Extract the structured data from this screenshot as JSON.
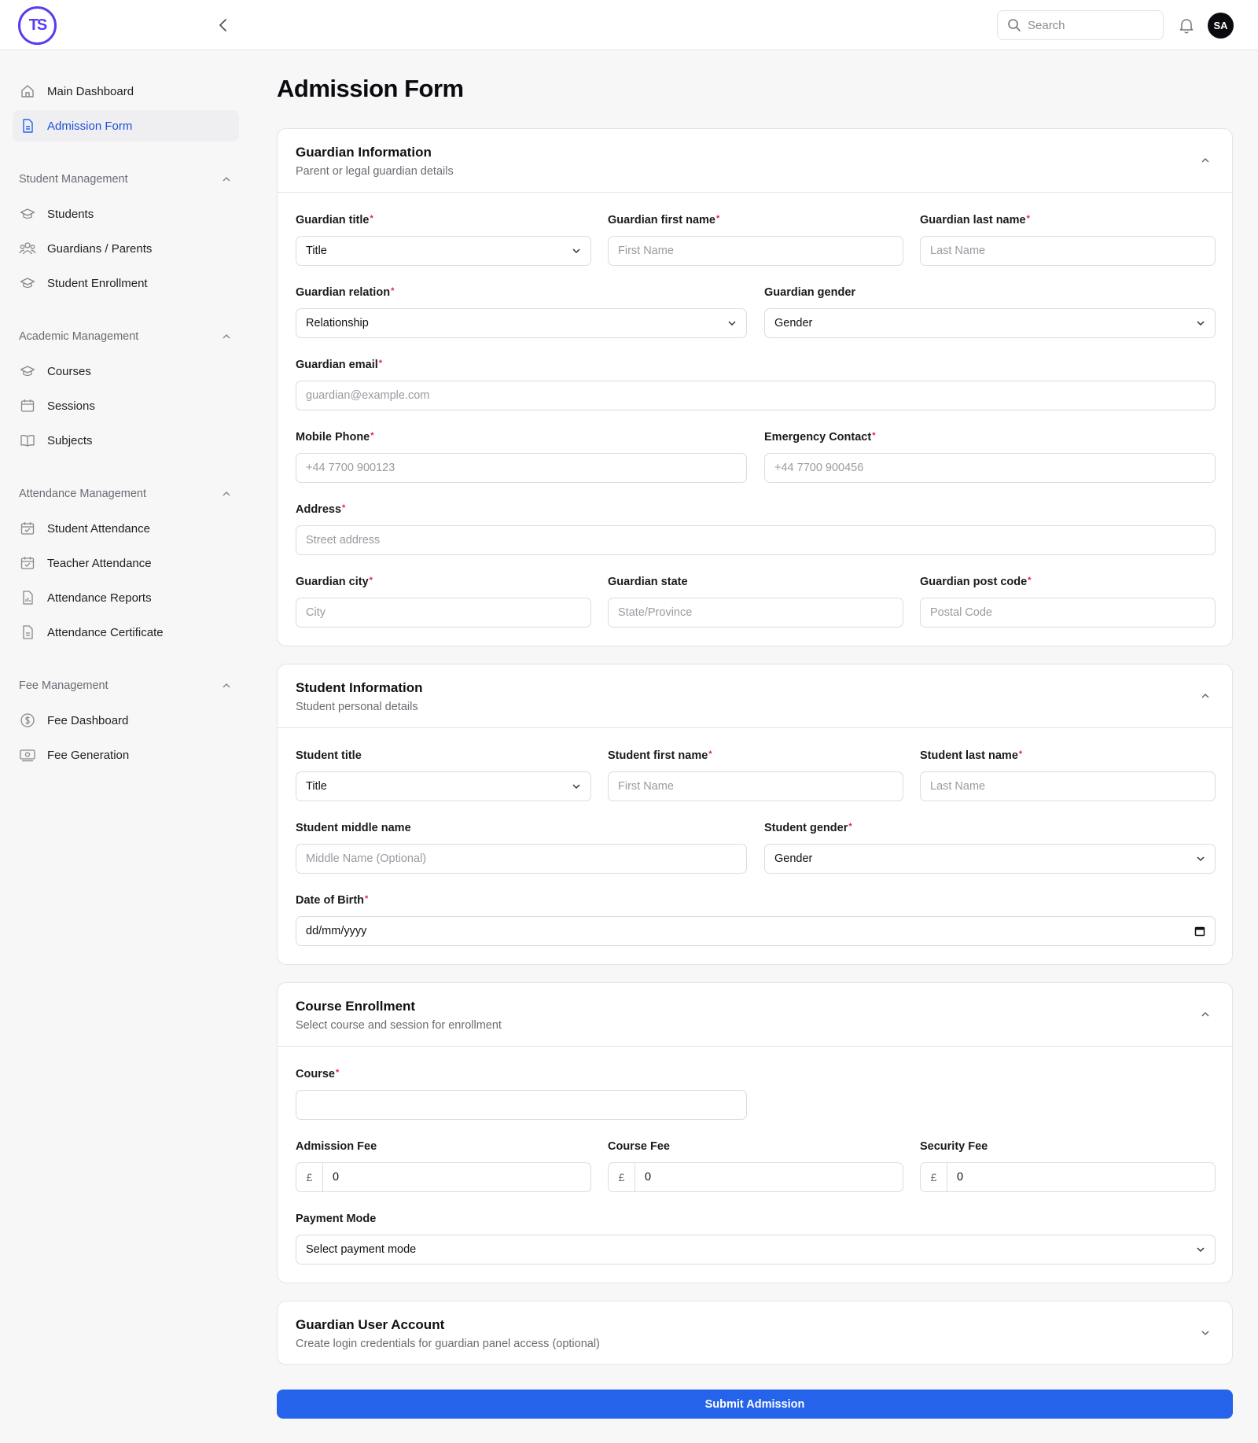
{
  "header": {
    "logo_text": "TS",
    "search_placeholder": "Search",
    "avatar_initials": "SA"
  },
  "sidebar": {
    "top_items": [
      {
        "label": "Main Dashboard",
        "icon": "home-icon"
      },
      {
        "label": "Admission Form",
        "icon": "document-icon",
        "active": true
      }
    ],
    "groups": [
      {
        "title": "Student Management",
        "items": [
          "Students",
          "Guardians / Parents",
          "Student Enrollment"
        ]
      },
      {
        "title": "Academic Management",
        "items": [
          "Courses",
          "Sessions",
          "Subjects"
        ]
      },
      {
        "title": "Attendance Management",
        "items": [
          "Student Attendance",
          "Teacher Attendance",
          "Attendance Reports",
          "Attendance Certificate"
        ]
      },
      {
        "title": "Fee Management",
        "items": [
          "Fee Dashboard",
          "Fee Generation"
        ]
      }
    ]
  },
  "page": {
    "title": "Admission Form"
  },
  "guardian": {
    "title": "Guardian Information",
    "subtitle": "Parent or legal guardian details",
    "title_label": "Guardian title",
    "title_value": "Title",
    "first_name_label": "Guardian first name",
    "first_name_placeholder": "First Name",
    "last_name_label": "Guardian last name",
    "last_name_placeholder": "Last Name",
    "relation_label": "Guardian relation",
    "relation_value": "Relationship",
    "gender_label": "Guardian gender",
    "gender_value": "Gender",
    "email_label": "Guardian email",
    "email_placeholder": "guardian@example.com",
    "mobile_label": "Mobile Phone",
    "mobile_placeholder": "+44 7700 900123",
    "emergency_label": "Emergency Contact",
    "emergency_placeholder": "+44 7700 900456",
    "address_label": "Address",
    "address_placeholder": "Street address",
    "city_label": "Guardian city",
    "city_placeholder": "City",
    "state_label": "Guardian state",
    "state_placeholder": "State/Province",
    "post_label": "Guardian post code",
    "post_placeholder": "Postal Code"
  },
  "student": {
    "title": "Student Information",
    "subtitle": "Student personal details",
    "title_label": "Student title",
    "title_value": "Title",
    "first_name_label": "Student first name",
    "first_name_placeholder": "First Name",
    "last_name_label": "Student last name",
    "last_name_placeholder": "Last Name",
    "middle_label": "Student middle name",
    "middle_placeholder": "Middle Name (Optional)",
    "gender_label": "Student gender",
    "gender_value": "Gender",
    "dob_label": "Date of Birth",
    "dob_value": "dd/mm/yyyy"
  },
  "course": {
    "title": "Course Enrollment",
    "subtitle": "Select course and session for enrollment",
    "course_label": "Course",
    "admission_fee_label": "Admission Fee",
    "course_fee_label": "Course Fee",
    "security_fee_label": "Security Fee",
    "currency": "£",
    "admission_fee": "0",
    "course_fee": "0",
    "security_fee": "0",
    "payment_label": "Payment Mode",
    "payment_value": "Select payment mode"
  },
  "account": {
    "title": "Guardian User Account",
    "subtitle": "Create login credentials for guardian panel access (optional)"
  },
  "submit_label": "Submit Admission",
  "colors": {
    "accent": "#2563eb",
    "logo": "#5b3cf0",
    "required": "#e11d48"
  }
}
